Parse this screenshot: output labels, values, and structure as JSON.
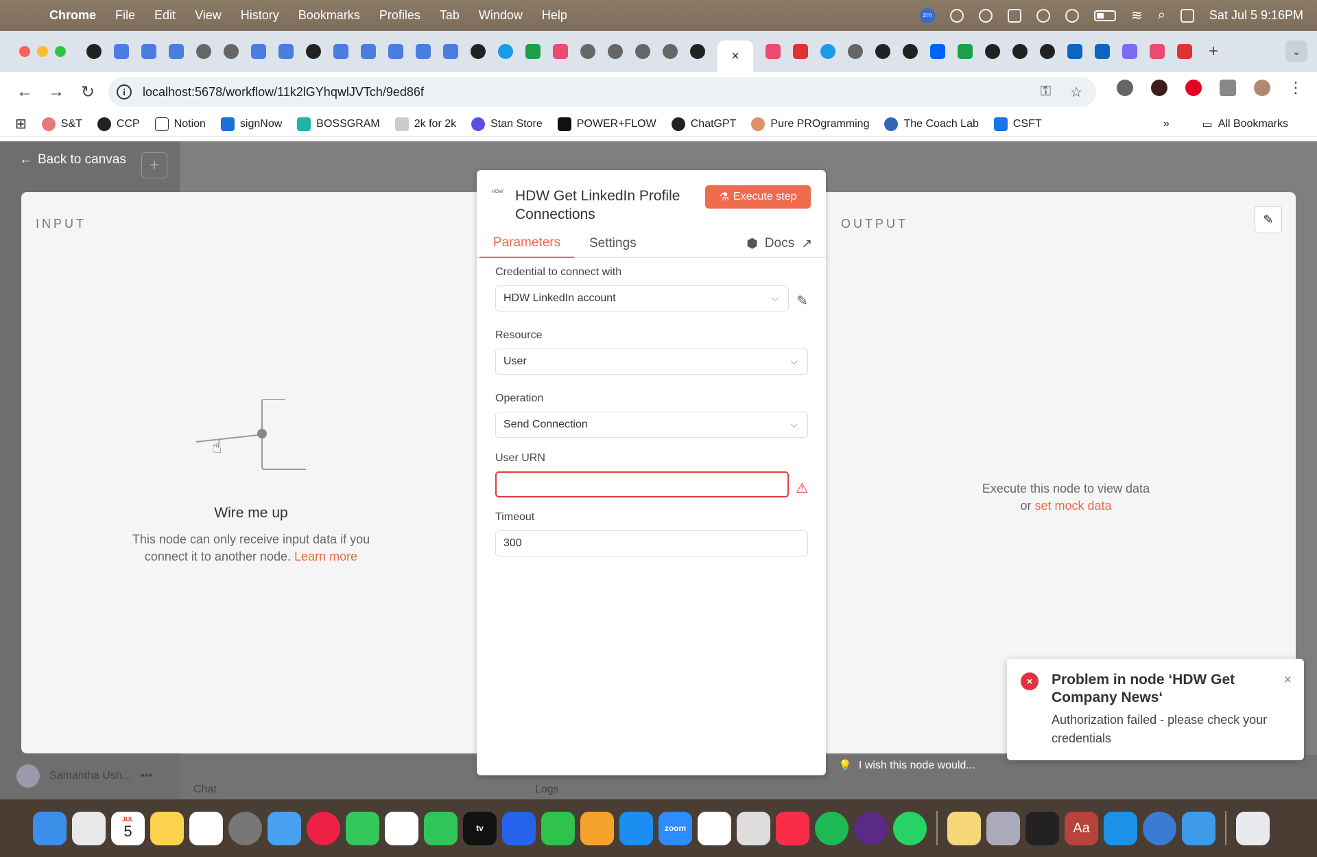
{
  "menubar": {
    "app": "Chrome",
    "items": [
      "File",
      "Edit",
      "View",
      "History",
      "Bookmarks",
      "Profiles",
      "Tab",
      "Window",
      "Help"
    ],
    "zoom_label": "zm",
    "clock": "Sat Jul 5  9:16PM"
  },
  "browser": {
    "url": "localhost:5678/workflow/11k2lGYhqwlJVTch/9ed86f",
    "active_tab_icon": "×",
    "bookmarks": [
      "S&T",
      "CCP",
      "Notion",
      "signNow",
      "BOSSGRAM",
      "2k for 2k",
      "Stan Store",
      "POWER+FLOW",
      "ChatGPT",
      "Pure PROgramming",
      "The Coach Lab",
      "CSFT"
    ],
    "all_bookmarks": "All Bookmarks"
  },
  "canvas": {
    "back_label": "Back to canvas",
    "wish_text": "I wish this node would...",
    "user_name": "Samantha Ush...",
    "chat_label": "Chat",
    "logs_label": "Logs"
  },
  "input_panel": {
    "label": "INPUT",
    "title": "Wire me up",
    "text": "This node can only receive input data if you connect it to another node.",
    "link": "Learn more"
  },
  "output_panel": {
    "label": "OUTPUT",
    "text_line1": "Execute this node to view data",
    "text_or": "or",
    "link": "set mock data"
  },
  "node": {
    "logo": "HDW",
    "title": "HDW Get LinkedIn Profile Connections",
    "execute_label": "Execute step",
    "tabs": {
      "parameters": "Parameters",
      "settings": "Settings",
      "docs": "Docs"
    },
    "fields": {
      "credential_label": "Credential to connect with",
      "credential_value": "HDW LinkedIn account",
      "resource_label": "Resource",
      "resource_value": "User",
      "operation_label": "Operation",
      "operation_value": "Send Connection",
      "urn_label": "User URN",
      "urn_value": "",
      "timeout_label": "Timeout",
      "timeout_value": "300"
    }
  },
  "toast": {
    "title": "Problem in node ‘HDW Get Company News‘",
    "message": "Authorization failed - please check your credentials"
  },
  "dock": {
    "calendar_month": "JUL",
    "calendar_day": "5",
    "tv_label": "tv",
    "zoom_label": "zoom",
    "dictionary_label": "Aa"
  }
}
